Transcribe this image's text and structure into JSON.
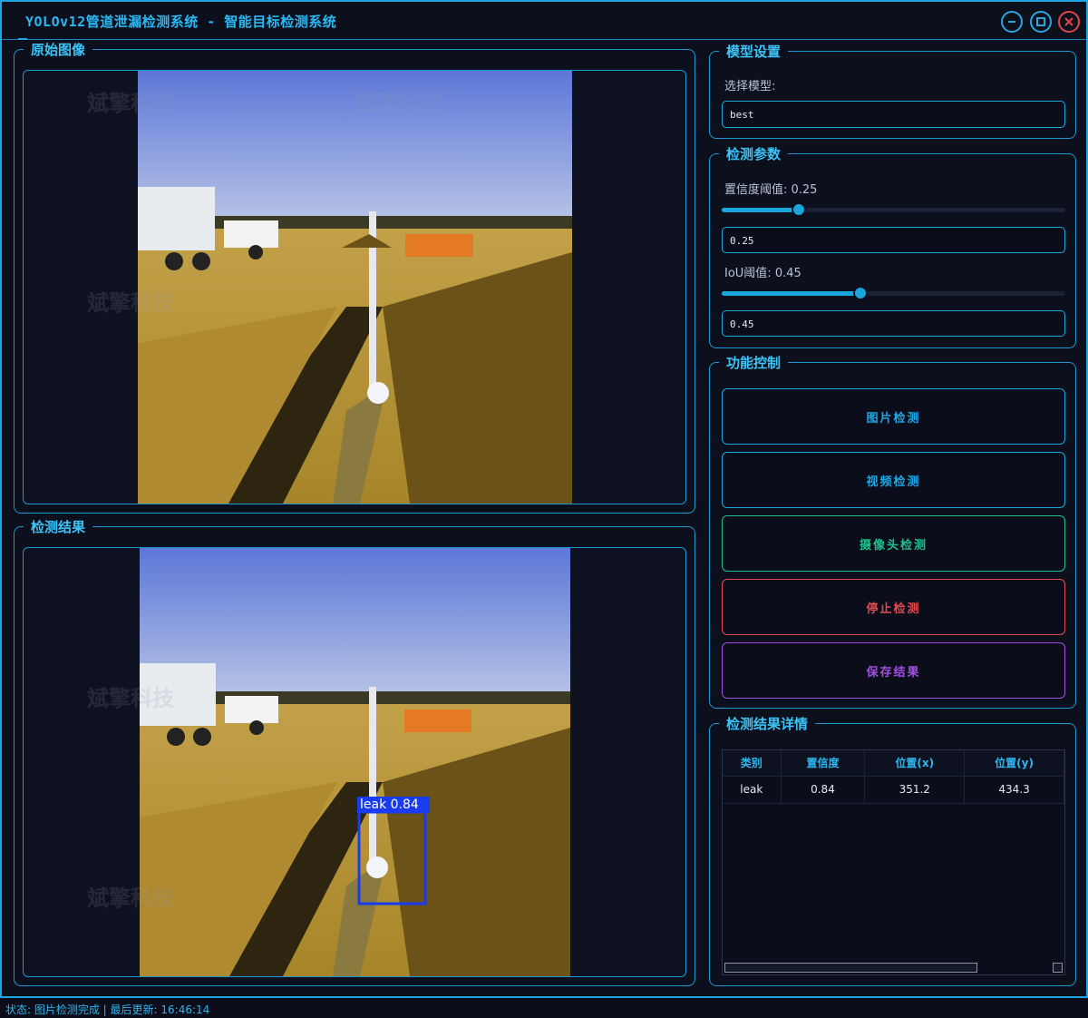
{
  "window": {
    "title": "YOLOv12管道泄漏检测系统 - 智能目标检测系统",
    "min_icon": "minimize-icon",
    "max_icon": "maximize-icon",
    "close_icon": "close-icon"
  },
  "original": {
    "title": "原始图像"
  },
  "result": {
    "title": "检测结果",
    "box_label": "leak 0.84"
  },
  "watermark": "斌擎科技",
  "model": {
    "title": "模型设置",
    "select_label": "选择模型:",
    "selected": "best"
  },
  "params": {
    "title": "检测参数",
    "conf_label": "置信度阈值: 0.25",
    "conf_value": "0.25",
    "conf_fraction": 0.25,
    "iou_label": "IoU阈值: 0.45",
    "iou_value": "0.45",
    "iou_fraction": 0.45
  },
  "controls": {
    "title": "功能控制",
    "image_btn": "图片检测",
    "video_btn": "视频检测",
    "camera_btn": "摄像头检测",
    "stop_btn": "停止检测",
    "save_btn": "保存结果",
    "colors": {
      "image": "#1ea7e4",
      "video": "#1ea7e4",
      "camera": "#1fc08a",
      "stop": "#e24b4f",
      "save": "#a14fe0"
    }
  },
  "details": {
    "title": "检测结果详情",
    "headers": [
      "类别",
      "置信度",
      "位置(x)",
      "位置(y)"
    ],
    "rows": [
      [
        "leak",
        "0.84",
        "351.2",
        "434.3"
      ]
    ]
  },
  "status": {
    "text": "状态: 图片检测完成 | 最后更新: 16:46:14"
  }
}
